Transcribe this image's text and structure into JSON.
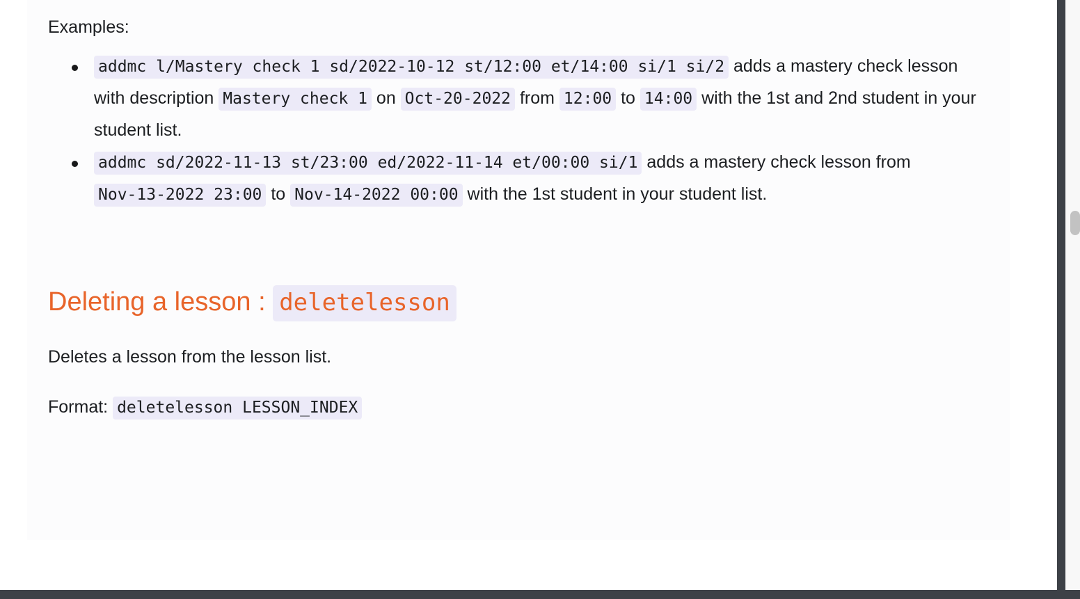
{
  "document": {
    "cut_off_line_above": "y",
    "examples_label": "Examples:",
    "examples": [
      {
        "command": "addmc l/Mastery check 1 sd/2022-10-12 st/12:00 et/14:00 si/1 si/2",
        "text_1": " adds a mastery check lesson with description ",
        "description": "Mastery check 1",
        "text_2": " on ",
        "date": "Oct-20-2022",
        "text_3": " from ",
        "start_time": "12:00",
        "text_4": " to ",
        "end_time": "14:00",
        "text_5": " with the 1st and 2nd student in your student list."
      },
      {
        "command": "addmc sd/2022-11-13 st/23:00 ed/2022-11-14 et/00:00 si/1",
        "text_1": " adds a mastery check lesson from ",
        "start_datetime": "Nov-13-2022 23:00",
        "text_2": " to ",
        "end_datetime": "Nov-14-2022 00:00",
        "text_3": " with the 1st student in your student list."
      }
    ],
    "delete_section": {
      "heading_text": "Deleting a lesson : ",
      "heading_code": "deletelesson",
      "description": "Deletes a lesson from the lesson list.",
      "format_label": "Format: ",
      "format_code": "deletelesson LESSON_INDEX"
    }
  },
  "chrome": {
    "scrollbar": "vertical-scrollbar"
  },
  "colors": {
    "heading_orange": "#e8642a",
    "code_background": "#eceaf8",
    "body_text": "#1c1e21",
    "card_background": "#fcfcfd",
    "window_edge": "#3d4147",
    "scrollbar_thumb": "#c2c2c2"
  }
}
